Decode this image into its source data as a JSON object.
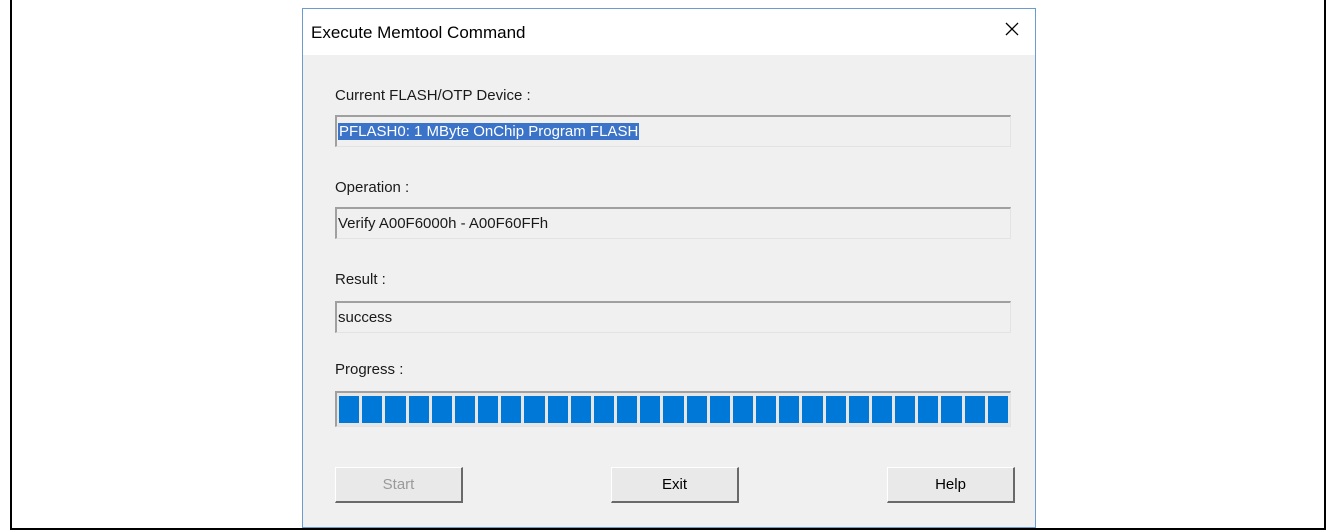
{
  "dialog": {
    "title": "Execute Memtool Command",
    "close_icon": "close-icon"
  },
  "device": {
    "label": "Current FLASH/OTP Device :",
    "value": "PFLASH0: 1 MByte OnChip Program FLASH"
  },
  "operation": {
    "label": "Operation :",
    "value": "Verify A00F6000h - A00F60FFh"
  },
  "result": {
    "label": "Result :",
    "value": "success"
  },
  "progress": {
    "label": "Progress :",
    "fraction": 1.0,
    "segments": 29,
    "color": "#0078d7"
  },
  "buttons": {
    "start": "Start",
    "exit": "Exit",
    "help": "Help"
  }
}
